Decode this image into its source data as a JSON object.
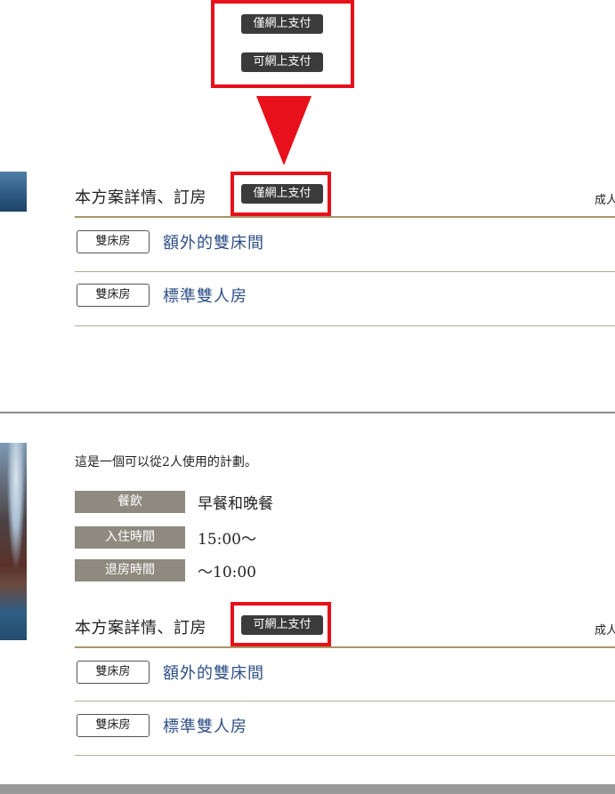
{
  "legend": {
    "badge_only_online": "僅網上支付",
    "badge_online_available": "可網上支付"
  },
  "colors": {
    "highlight_red": "#e8101a",
    "badge_dark": "#3b3b3b",
    "room_link_blue": "#2e4f86",
    "label_gray": "#8e8a80",
    "rule_gold": "#a89668"
  },
  "plan1": {
    "title": "本方案詳情、訂房",
    "payment_badge": "僅網上支付",
    "adult_label": "成人",
    "rooms": [
      {
        "tag": "雙床房",
        "name": "額外的雙床間"
      },
      {
        "tag": "雙床房",
        "name": "標準雙人房"
      }
    ]
  },
  "plan2": {
    "description": "這是一個可以從2人使用的計劃。",
    "info": [
      {
        "label": "餐飲",
        "value": "早餐和晚餐"
      },
      {
        "label": "入住時間",
        "value": "15:00〜"
      },
      {
        "label": "退房時間",
        "value": "〜10:00"
      }
    ],
    "title": "本方案詳情、訂房",
    "payment_badge": "可網上支付",
    "adult_label": "成人",
    "rooms": [
      {
        "tag": "雙床房",
        "name": "額外的雙床間"
      },
      {
        "tag": "雙床房",
        "name": "標準雙人房"
      }
    ]
  }
}
